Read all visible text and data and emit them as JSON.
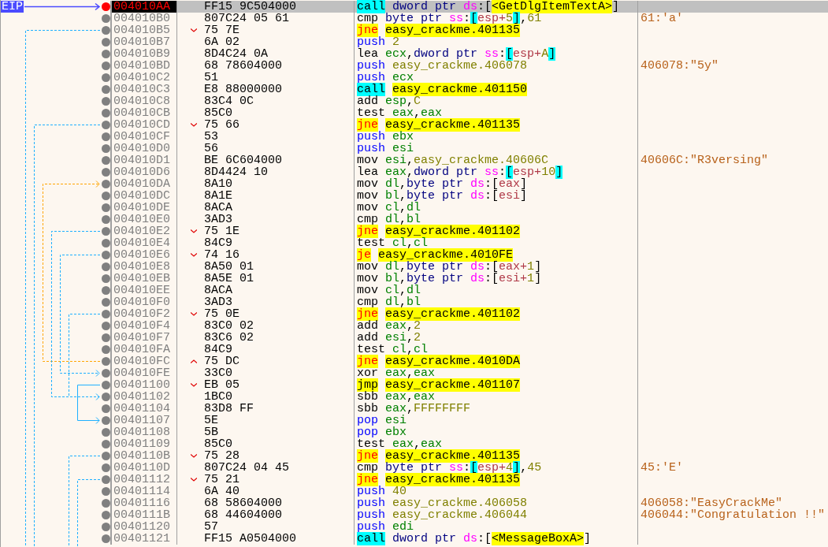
{
  "eip_label": "EIP",
  "rows": [
    {
      "address": "004010AA",
      "current": true,
      "breakpoint": true,
      "branch_down": false,
      "branch_up": false,
      "bytes": "FF15 9C504000",
      "instruction": [
        {
          "text": "call",
          "kind": "call"
        },
        {
          "text": " dword ptr ",
          "kind": "size"
        },
        {
          "text": "ds",
          "kind": "seg"
        },
        {
          "text": ":[",
          "kind": "plain"
        },
        {
          "text": "<GetDlgItemTextA>",
          "kind": "target"
        },
        {
          "text": "]",
          "kind": "plain"
        }
      ]
    },
    {
      "address": "004010B0",
      "current": false,
      "breakpoint": false,
      "branch_down": false,
      "branch_up": false,
      "bytes": "807C24 05 61",
      "instruction": [
        {
          "text": "cmp",
          "kind": "op"
        },
        {
          "text": " byte ptr ",
          "kind": "size"
        },
        {
          "text": "ss",
          "kind": "seg"
        },
        {
          "text": ":",
          "kind": "plain"
        },
        {
          "text": "[",
          "kind": "bracket"
        },
        {
          "text": "esp+",
          "kind": "mem"
        },
        {
          "text": "5",
          "kind": "num"
        },
        {
          "text": "]",
          "kind": "bracket"
        },
        {
          "text": ",",
          "kind": "plain"
        },
        {
          "text": "61",
          "kind": "num"
        }
      ],
      "comment": "61:'a'"
    },
    {
      "address": "004010B5",
      "current": false,
      "breakpoint": false,
      "branch_down": true,
      "branch_up": false,
      "bytes": "75 7E",
      "instruction": [
        {
          "text": "jne",
          "kind": "jcc"
        },
        {
          "text": "easy_crackme.401135",
          "kind": "target",
          "gap": true
        }
      ]
    },
    {
      "address": "004010B7",
      "current": false,
      "breakpoint": false,
      "branch_down": false,
      "branch_up": false,
      "bytes": "6A 02",
      "instruction": [
        {
          "text": "push",
          "kind": "stack"
        },
        {
          "text": " 2",
          "kind": "num"
        }
      ]
    },
    {
      "address": "004010B9",
      "current": false,
      "breakpoint": false,
      "branch_down": false,
      "branch_up": false,
      "bytes": "8D4C24 0A",
      "instruction": [
        {
          "text": "lea",
          "kind": "op"
        },
        {
          "text": " ecx",
          "kind": "reg"
        },
        {
          "text": ",",
          "kind": "plain"
        },
        {
          "text": "dword ptr ",
          "kind": "size"
        },
        {
          "text": "ss",
          "kind": "seg"
        },
        {
          "text": ":",
          "kind": "plain"
        },
        {
          "text": "[",
          "kind": "bracket"
        },
        {
          "text": "esp+",
          "kind": "mem"
        },
        {
          "text": "A",
          "kind": "num"
        },
        {
          "text": "]",
          "kind": "bracket"
        }
      ]
    },
    {
      "address": "004010BD",
      "current": false,
      "breakpoint": false,
      "branch_down": false,
      "branch_up": false,
      "bytes": "68 78604000",
      "instruction": [
        {
          "text": "push",
          "kind": "stack"
        },
        {
          "text": " easy_crackme.406078",
          "kind": "addr"
        }
      ],
      "comment": "406078:\"5y\""
    },
    {
      "address": "004010C2",
      "current": false,
      "breakpoint": false,
      "branch_down": false,
      "branch_up": false,
      "bytes": "51",
      "instruction": [
        {
          "text": "push",
          "kind": "stack"
        },
        {
          "text": " ecx",
          "kind": "reg"
        }
      ]
    },
    {
      "address": "004010C3",
      "current": false,
      "breakpoint": false,
      "branch_down": false,
      "branch_up": false,
      "bytes": "E8 88000000",
      "instruction": [
        {
          "text": "call",
          "kind": "call"
        },
        {
          "text": "easy_crackme.401150",
          "kind": "target",
          "gap": true
        }
      ]
    },
    {
      "address": "004010C8",
      "current": false,
      "breakpoint": false,
      "branch_down": false,
      "branch_up": false,
      "bytes": "83C4 0C",
      "instruction": [
        {
          "text": "add",
          "kind": "op"
        },
        {
          "text": " esp",
          "kind": "reg"
        },
        {
          "text": ",",
          "kind": "plain"
        },
        {
          "text": "C",
          "kind": "num"
        }
      ]
    },
    {
      "address": "004010CB",
      "current": false,
      "breakpoint": false,
      "branch_down": false,
      "branch_up": false,
      "bytes": "85C0",
      "instruction": [
        {
          "text": "test",
          "kind": "op"
        },
        {
          "text": " eax",
          "kind": "reg"
        },
        {
          "text": ",",
          "kind": "plain"
        },
        {
          "text": "eax",
          "kind": "reg"
        }
      ]
    },
    {
      "address": "004010CD",
      "current": false,
      "breakpoint": false,
      "branch_down": true,
      "branch_up": false,
      "bytes": "75 66",
      "instruction": [
        {
          "text": "jne",
          "kind": "jcc"
        },
        {
          "text": "easy_crackme.401135",
          "kind": "target",
          "gap": true
        }
      ]
    },
    {
      "address": "004010CF",
      "current": false,
      "breakpoint": false,
      "branch_down": false,
      "branch_up": false,
      "bytes": "53",
      "instruction": [
        {
          "text": "push",
          "kind": "stack"
        },
        {
          "text": " ebx",
          "kind": "reg"
        }
      ]
    },
    {
      "address": "004010D0",
      "current": false,
      "breakpoint": false,
      "branch_down": false,
      "branch_up": false,
      "bytes": "56",
      "instruction": [
        {
          "text": "push",
          "kind": "stack"
        },
        {
          "text": " esi",
          "kind": "reg"
        }
      ]
    },
    {
      "address": "004010D1",
      "current": false,
      "breakpoint": false,
      "branch_down": false,
      "branch_up": false,
      "bytes": "BE 6C604000",
      "instruction": [
        {
          "text": "mov",
          "kind": "op"
        },
        {
          "text": " esi",
          "kind": "reg"
        },
        {
          "text": ",",
          "kind": "plain"
        },
        {
          "text": "easy_crackme.40606C",
          "kind": "addr"
        }
      ],
      "comment": "40606C:\"R3versing\""
    },
    {
      "address": "004010D6",
      "current": false,
      "breakpoint": false,
      "branch_down": false,
      "branch_up": false,
      "bytes": "8D4424 10",
      "instruction": [
        {
          "text": "lea",
          "kind": "op"
        },
        {
          "text": " eax",
          "kind": "reg"
        },
        {
          "text": ",",
          "kind": "plain"
        },
        {
          "text": "dword ptr ",
          "kind": "size"
        },
        {
          "text": "ss",
          "kind": "seg"
        },
        {
          "text": ":",
          "kind": "plain"
        },
        {
          "text": "[",
          "kind": "bracket"
        },
        {
          "text": "esp+",
          "kind": "mem"
        },
        {
          "text": "10",
          "kind": "num"
        },
        {
          "text": "]",
          "kind": "bracket"
        }
      ]
    },
    {
      "address": "004010DA",
      "current": false,
      "breakpoint": false,
      "branch_down": false,
      "branch_up": false,
      "bytes": "8A10",
      "instruction": [
        {
          "text": "mov",
          "kind": "op"
        },
        {
          "text": " dl",
          "kind": "reg"
        },
        {
          "text": ",",
          "kind": "plain"
        },
        {
          "text": "byte ptr ",
          "kind": "size"
        },
        {
          "text": "ds",
          "kind": "seg"
        },
        {
          "text": ":[",
          "kind": "plain"
        },
        {
          "text": "eax",
          "kind": "mem"
        },
        {
          "text": "]",
          "kind": "plain"
        }
      ]
    },
    {
      "address": "004010DC",
      "current": false,
      "breakpoint": false,
      "branch_down": false,
      "branch_up": false,
      "bytes": "8A1E",
      "instruction": [
        {
          "text": "mov",
          "kind": "op"
        },
        {
          "text": " bl",
          "kind": "reg"
        },
        {
          "text": ",",
          "kind": "plain"
        },
        {
          "text": "byte ptr ",
          "kind": "size"
        },
        {
          "text": "ds",
          "kind": "seg"
        },
        {
          "text": ":[",
          "kind": "plain"
        },
        {
          "text": "esi",
          "kind": "mem"
        },
        {
          "text": "]",
          "kind": "plain"
        }
      ]
    },
    {
      "address": "004010DE",
      "current": false,
      "breakpoint": false,
      "branch_down": false,
      "branch_up": false,
      "bytes": "8ACA",
      "instruction": [
        {
          "text": "mov",
          "kind": "op"
        },
        {
          "text": " cl",
          "kind": "reg"
        },
        {
          "text": ",",
          "kind": "plain"
        },
        {
          "text": "dl",
          "kind": "reg"
        }
      ]
    },
    {
      "address": "004010E0",
      "current": false,
      "breakpoint": false,
      "branch_down": false,
      "branch_up": false,
      "bytes": "3AD3",
      "instruction": [
        {
          "text": "cmp",
          "kind": "op"
        },
        {
          "text": " dl",
          "kind": "reg"
        },
        {
          "text": ",",
          "kind": "plain"
        },
        {
          "text": "bl",
          "kind": "reg"
        }
      ]
    },
    {
      "address": "004010E2",
      "current": false,
      "breakpoint": false,
      "branch_down": true,
      "branch_up": false,
      "bytes": "75 1E",
      "instruction": [
        {
          "text": "jne",
          "kind": "jcc"
        },
        {
          "text": "easy_crackme.401102",
          "kind": "target",
          "gap": true
        }
      ]
    },
    {
      "address": "004010E4",
      "current": false,
      "breakpoint": false,
      "branch_down": false,
      "branch_up": false,
      "bytes": "84C9",
      "instruction": [
        {
          "text": "test",
          "kind": "op"
        },
        {
          "text": " cl",
          "kind": "reg"
        },
        {
          "text": ",",
          "kind": "plain"
        },
        {
          "text": "cl",
          "kind": "reg"
        }
      ]
    },
    {
      "address": "004010E6",
      "current": false,
      "breakpoint": false,
      "branch_down": true,
      "branch_up": false,
      "bytes": "74 16",
      "instruction": [
        {
          "text": "je",
          "kind": "jcc"
        },
        {
          "text": "easy_crackme.4010FE",
          "kind": "target",
          "gap": true
        }
      ]
    },
    {
      "address": "004010E8",
      "current": false,
      "breakpoint": false,
      "branch_down": false,
      "branch_up": false,
      "bytes": "8A50 01",
      "instruction": [
        {
          "text": "mov",
          "kind": "op"
        },
        {
          "text": " dl",
          "kind": "reg"
        },
        {
          "text": ",",
          "kind": "plain"
        },
        {
          "text": "byte ptr ",
          "kind": "size"
        },
        {
          "text": "ds",
          "kind": "seg"
        },
        {
          "text": ":[",
          "kind": "plain"
        },
        {
          "text": "eax+",
          "kind": "mem"
        },
        {
          "text": "1",
          "kind": "num"
        },
        {
          "text": "]",
          "kind": "plain"
        }
      ]
    },
    {
      "address": "004010EB",
      "current": false,
      "breakpoint": false,
      "branch_down": false,
      "branch_up": false,
      "bytes": "8A5E 01",
      "instruction": [
        {
          "text": "mov",
          "kind": "op"
        },
        {
          "text": " bl",
          "kind": "reg"
        },
        {
          "text": ",",
          "kind": "plain"
        },
        {
          "text": "byte ptr ",
          "kind": "size"
        },
        {
          "text": "ds",
          "kind": "seg"
        },
        {
          "text": ":[",
          "kind": "plain"
        },
        {
          "text": "esi+",
          "kind": "mem"
        },
        {
          "text": "1",
          "kind": "num"
        },
        {
          "text": "]",
          "kind": "plain"
        }
      ]
    },
    {
      "address": "004010EE",
      "current": false,
      "breakpoint": false,
      "branch_down": false,
      "branch_up": false,
      "bytes": "8ACA",
      "instruction": [
        {
          "text": "mov",
          "kind": "op"
        },
        {
          "text": " cl",
          "kind": "reg"
        },
        {
          "text": ",",
          "kind": "plain"
        },
        {
          "text": "dl",
          "kind": "reg"
        }
      ]
    },
    {
      "address": "004010F0",
      "current": false,
      "breakpoint": false,
      "branch_down": false,
      "branch_up": false,
      "bytes": "3AD3",
      "instruction": [
        {
          "text": "cmp",
          "kind": "op"
        },
        {
          "text": " dl",
          "kind": "reg"
        },
        {
          "text": ",",
          "kind": "plain"
        },
        {
          "text": "bl",
          "kind": "reg"
        }
      ]
    },
    {
      "address": "004010F2",
      "current": false,
      "breakpoint": false,
      "branch_down": true,
      "branch_up": false,
      "bytes": "75 0E",
      "instruction": [
        {
          "text": "jne",
          "kind": "jcc"
        },
        {
          "text": "easy_crackme.401102",
          "kind": "target",
          "gap": true
        }
      ]
    },
    {
      "address": "004010F4",
      "current": false,
      "breakpoint": false,
      "branch_down": false,
      "branch_up": false,
      "bytes": "83C0 02",
      "instruction": [
        {
          "text": "add",
          "kind": "op"
        },
        {
          "text": " eax",
          "kind": "reg"
        },
        {
          "text": ",",
          "kind": "plain"
        },
        {
          "text": "2",
          "kind": "num"
        }
      ]
    },
    {
      "address": "004010F7",
      "current": false,
      "breakpoint": false,
      "branch_down": false,
      "branch_up": false,
      "bytes": "83C6 02",
      "instruction": [
        {
          "text": "add",
          "kind": "op"
        },
        {
          "text": " esi",
          "kind": "reg"
        },
        {
          "text": ",",
          "kind": "plain"
        },
        {
          "text": "2",
          "kind": "num"
        }
      ]
    },
    {
      "address": "004010FA",
      "current": false,
      "breakpoint": false,
      "branch_down": false,
      "branch_up": false,
      "bytes": "84C9",
      "instruction": [
        {
          "text": "test",
          "kind": "op"
        },
        {
          "text": " cl",
          "kind": "reg"
        },
        {
          "text": ",",
          "kind": "plain"
        },
        {
          "text": "cl",
          "kind": "reg"
        }
      ]
    },
    {
      "address": "004010FC",
      "current": false,
      "breakpoint": false,
      "branch_down": false,
      "branch_up": true,
      "bytes": "75 DC",
      "instruction": [
        {
          "text": "jne",
          "kind": "jcc"
        },
        {
          "text": "easy_crackme.4010DA",
          "kind": "target",
          "gap": true
        }
      ]
    },
    {
      "address": "004010FE",
      "current": false,
      "breakpoint": false,
      "branch_down": false,
      "branch_up": false,
      "bytes": "33C0",
      "instruction": [
        {
          "text": "xor",
          "kind": "op"
        },
        {
          "text": " eax",
          "kind": "reg"
        },
        {
          "text": ",",
          "kind": "plain"
        },
        {
          "text": "eax",
          "kind": "reg"
        }
      ]
    },
    {
      "address": "00401100",
      "current": false,
      "breakpoint": false,
      "branch_down": true,
      "branch_up": false,
      "bytes": "EB 05",
      "instruction": [
        {
          "text": "jmp",
          "kind": "jmp"
        },
        {
          "text": "easy_crackme.401107",
          "kind": "target",
          "gap": true
        }
      ]
    },
    {
      "address": "00401102",
      "current": false,
      "breakpoint": false,
      "branch_down": false,
      "branch_up": false,
      "bytes": "1BC0",
      "instruction": [
        {
          "text": "sbb",
          "kind": "op"
        },
        {
          "text": " eax",
          "kind": "reg"
        },
        {
          "text": ",",
          "kind": "plain"
        },
        {
          "text": "eax",
          "kind": "reg"
        }
      ]
    },
    {
      "address": "00401104",
      "current": false,
      "breakpoint": false,
      "branch_down": false,
      "branch_up": false,
      "bytes": "83D8 FF",
      "instruction": [
        {
          "text": "sbb",
          "kind": "op"
        },
        {
          "text": " eax",
          "kind": "reg"
        },
        {
          "text": ",",
          "kind": "plain"
        },
        {
          "text": "FFFFFFFF",
          "kind": "num"
        }
      ]
    },
    {
      "address": "00401107",
      "current": false,
      "breakpoint": false,
      "branch_down": false,
      "branch_up": false,
      "bytes": "5E",
      "instruction": [
        {
          "text": "pop",
          "kind": "stack"
        },
        {
          "text": " esi",
          "kind": "reg"
        }
      ]
    },
    {
      "address": "00401108",
      "current": false,
      "breakpoint": false,
      "branch_down": false,
      "branch_up": false,
      "bytes": "5B",
      "instruction": [
        {
          "text": "pop",
          "kind": "stack"
        },
        {
          "text": " ebx",
          "kind": "reg"
        }
      ]
    },
    {
      "address": "00401109",
      "current": false,
      "breakpoint": false,
      "branch_down": false,
      "branch_up": false,
      "bytes": "85C0",
      "instruction": [
        {
          "text": "test",
          "kind": "op"
        },
        {
          "text": " eax",
          "kind": "reg"
        },
        {
          "text": ",",
          "kind": "plain"
        },
        {
          "text": "eax",
          "kind": "reg"
        }
      ]
    },
    {
      "address": "0040110B",
      "current": false,
      "breakpoint": false,
      "branch_down": true,
      "branch_up": false,
      "bytes": "75 28",
      "instruction": [
        {
          "text": "jne",
          "kind": "jcc"
        },
        {
          "text": "easy_crackme.401135",
          "kind": "target",
          "gap": true
        }
      ]
    },
    {
      "address": "0040110D",
      "current": false,
      "breakpoint": false,
      "branch_down": false,
      "branch_up": false,
      "bytes": "807C24 04 45",
      "instruction": [
        {
          "text": "cmp",
          "kind": "op"
        },
        {
          "text": " byte ptr ",
          "kind": "size"
        },
        {
          "text": "ss",
          "kind": "seg"
        },
        {
          "text": ":",
          "kind": "plain"
        },
        {
          "text": "[",
          "kind": "bracket"
        },
        {
          "text": "esp+",
          "kind": "mem"
        },
        {
          "text": "4",
          "kind": "num"
        },
        {
          "text": "]",
          "kind": "bracket"
        },
        {
          "text": ",",
          "kind": "plain"
        },
        {
          "text": "45",
          "kind": "num"
        }
      ],
      "comment": "45:'E'"
    },
    {
      "address": "00401112",
      "current": false,
      "breakpoint": false,
      "branch_down": true,
      "branch_up": false,
      "bytes": "75 21",
      "instruction": [
        {
          "text": "jne",
          "kind": "jcc"
        },
        {
          "text": "easy_crackme.401135",
          "kind": "target",
          "gap": true
        }
      ]
    },
    {
      "address": "00401114",
      "current": false,
      "breakpoint": false,
      "branch_down": false,
      "branch_up": false,
      "bytes": "6A 40",
      "instruction": [
        {
          "text": "push",
          "kind": "stack"
        },
        {
          "text": " 40",
          "kind": "num"
        }
      ]
    },
    {
      "address": "00401116",
      "current": false,
      "breakpoint": false,
      "branch_down": false,
      "branch_up": false,
      "bytes": "68 58604000",
      "instruction": [
        {
          "text": "push",
          "kind": "stack"
        },
        {
          "text": " easy_crackme.406058",
          "kind": "addr"
        }
      ],
      "comment": "406058:\"EasyCrackMe\""
    },
    {
      "address": "0040111B",
      "current": false,
      "breakpoint": false,
      "branch_down": false,
      "branch_up": false,
      "bytes": "68 44604000",
      "instruction": [
        {
          "text": "push",
          "kind": "stack"
        },
        {
          "text": " easy_crackme.406044",
          "kind": "addr"
        }
      ],
      "comment": "406044:\"Congratulation !!\""
    },
    {
      "address": "00401120",
      "current": false,
      "breakpoint": false,
      "branch_down": false,
      "branch_up": false,
      "bytes": "57",
      "instruction": [
        {
          "text": "push",
          "kind": "stack"
        },
        {
          "text": " edi",
          "kind": "reg"
        }
      ]
    },
    {
      "address": "00401121",
      "current": false,
      "breakpoint": false,
      "branch_down": false,
      "branch_up": false,
      "bytes": "FF15 A0504000",
      "instruction": [
        {
          "text": "call",
          "kind": "call"
        },
        {
          "text": " dword ptr ",
          "kind": "size"
        },
        {
          "text": "ds",
          "kind": "seg"
        },
        {
          "text": ":[",
          "kind": "plain"
        },
        {
          "text": "<MessageBoxA>",
          "kind": "target"
        },
        {
          "text": "]",
          "kind": "plain"
        }
      ]
    }
  ]
}
